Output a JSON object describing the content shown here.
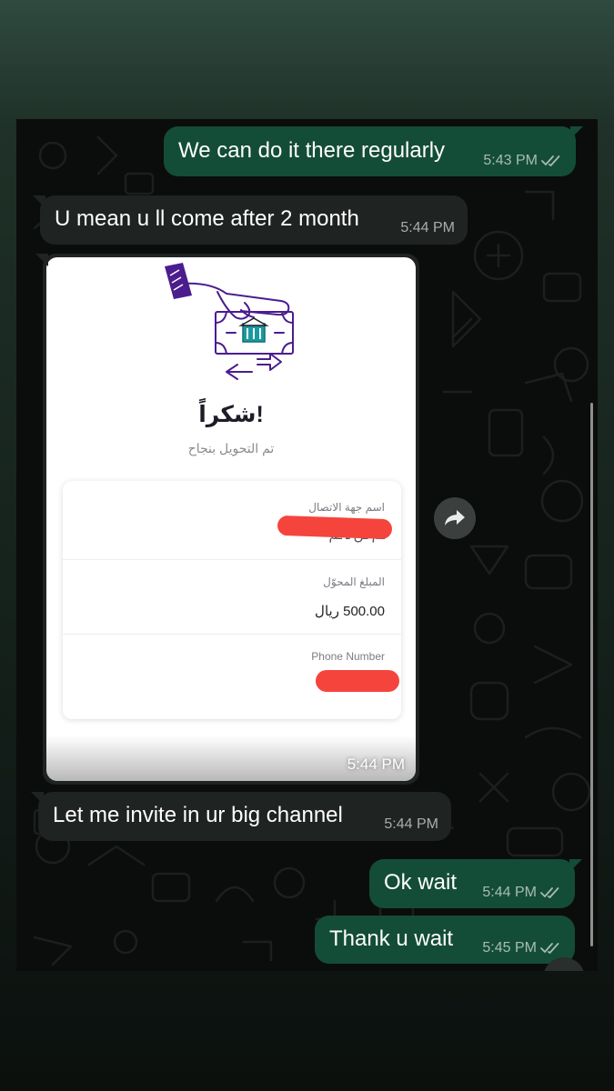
{
  "messages": [
    {
      "text": "We can do it there regularly",
      "time": "5:43 PM",
      "direction": "outgoing",
      "status": "read"
    },
    {
      "text": "U mean u ll come after 2 month",
      "time": "5:44 PM",
      "direction": "incoming"
    },
    {
      "text": "Let me invite in ur big channel",
      "time": "5:44 PM",
      "direction": "incoming"
    },
    {
      "text": "Ok wait",
      "time": "5:44 PM",
      "direction": "outgoing",
      "status": "read"
    },
    {
      "text": "Thank u wait",
      "time": "5:45 PM",
      "direction": "outgoing",
      "status": "read"
    }
  ],
  "image_message": {
    "time": "5:44 PM",
    "receipt": {
      "title": "شكراً!",
      "subtitle": "تم التحويل بنجاح",
      "contact_label": "اسم جهة الاتصال",
      "contact_value_partial": "ـم ـن ـ ـم",
      "amount_label": "المبلغ المحوّل",
      "amount_value": "500.00 ريال",
      "phone_label": "Phone Number"
    }
  },
  "icons": {
    "forward": "forward-arrow-icon",
    "read_receipt": "double-check-icon",
    "illustration": "hand-money-transfer-icon"
  },
  "colors": {
    "outgoing_bubble": "#144d37",
    "incoming_bubble": "#1f2321",
    "chat_background": "#0b0d0c",
    "illustration_purple": "#4b1d8f",
    "bank_teal": "#1a9aa0",
    "redaction": "#f5443c"
  }
}
